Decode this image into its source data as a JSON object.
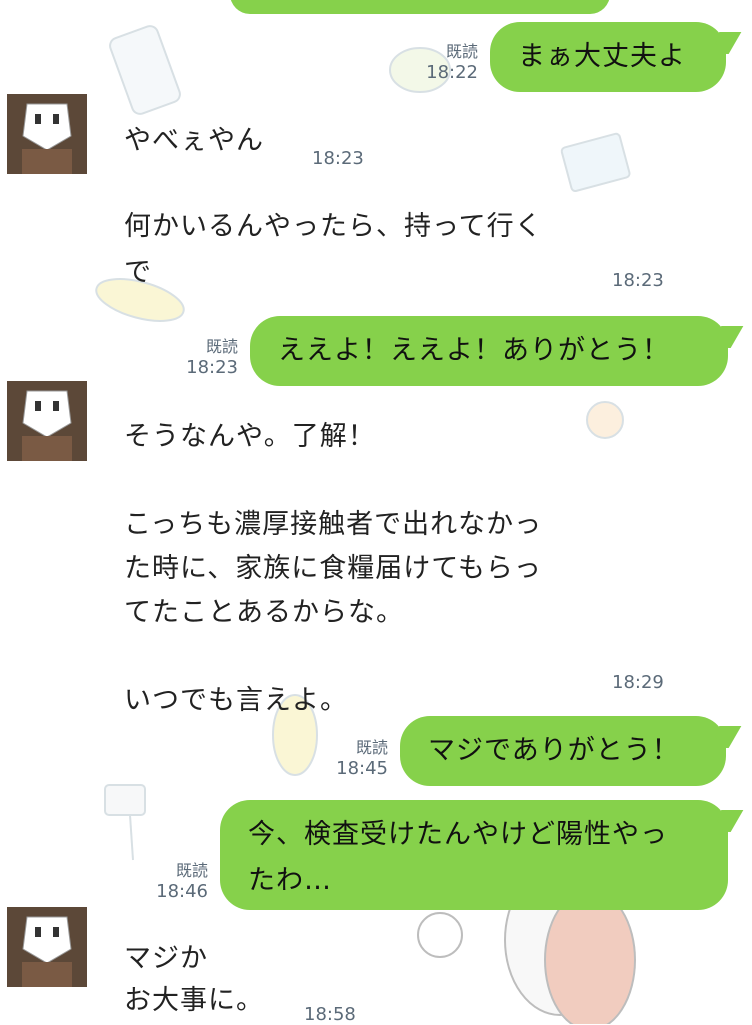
{
  "chat": {
    "messages": [
      {
        "side": "out",
        "text": "まぁ大丈夫よ",
        "read": "既読",
        "time": "18:22"
      },
      {
        "side": "in",
        "text": "やべぇやん",
        "time": "18:23"
      },
      {
        "side": "in",
        "text": "何かいるんやったら、持って行く\nで",
        "time": "18:23"
      },
      {
        "side": "out",
        "text": "ええよ！ええよ！ありがとう！",
        "read": "既読",
        "time": "18:23"
      },
      {
        "side": "in",
        "text": "そうなんや。了解！\n\nこっちも濃厚接触者で出れなかっ\nた時に、家族に食糧届けてもらっ\nてたことあるからな。\n\nいつでも言えよ。",
        "time": "18:29"
      },
      {
        "side": "out",
        "text": "マジでありがとう！",
        "read": "既読",
        "time": "18:45"
      },
      {
        "side": "out",
        "text": "今、検査受けたんやけど陽性やっ\nたわ…",
        "read": "既読",
        "time": "18:46"
      },
      {
        "side": "in",
        "text": "マジか\nお大事に。",
        "time": "18:58"
      }
    ]
  },
  "colors": {
    "bubble": "#86D14B",
    "time": "#5b6a78",
    "background": "#ffffff"
  },
  "icons": [
    "avatar-photo",
    "background-sticker-doodles"
  ]
}
